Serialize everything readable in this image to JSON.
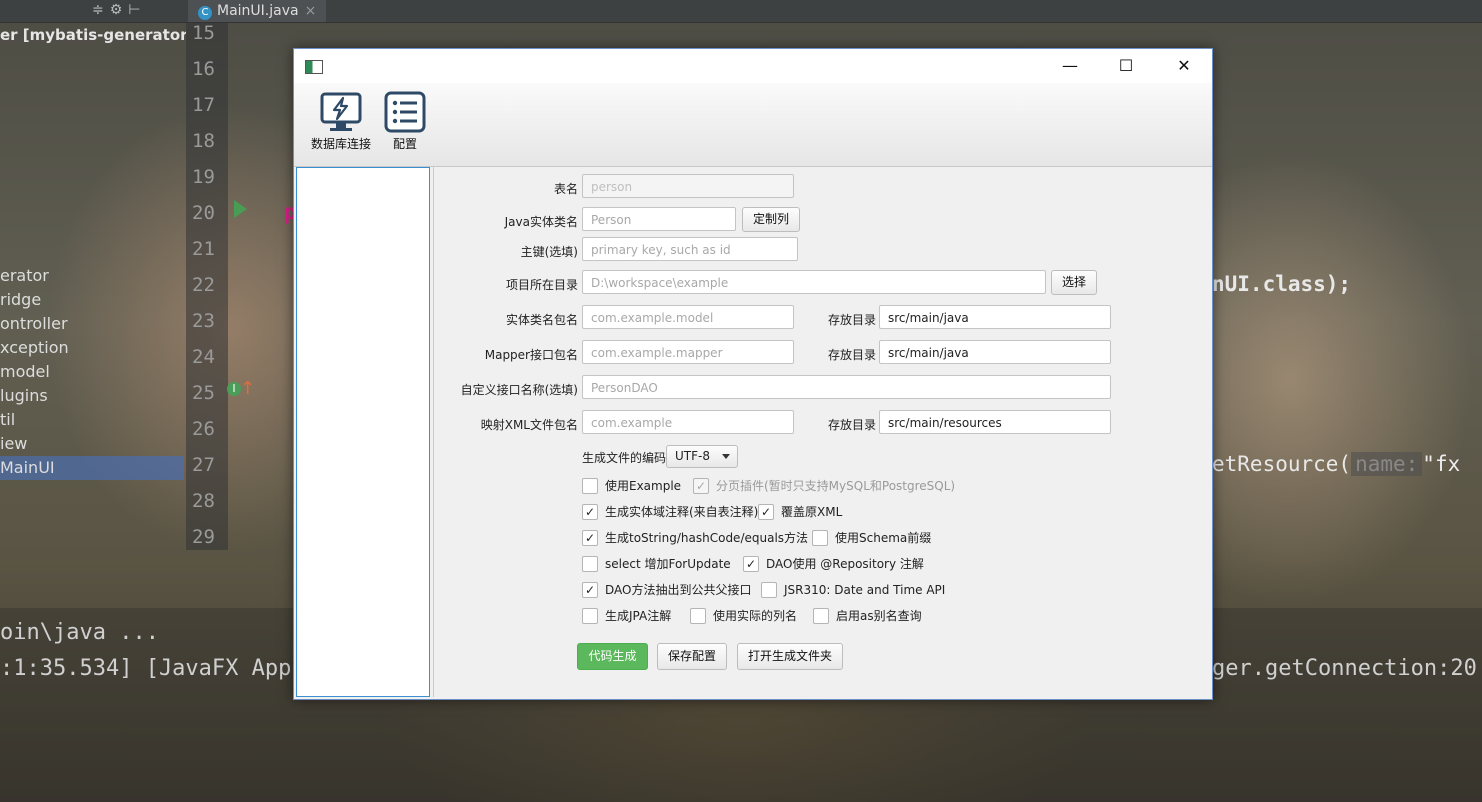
{
  "ide": {
    "tab_label": "MainUI.java",
    "project_title": "er [mybatis-generator-gu",
    "project_items": [
      "erator",
      "ridge",
      "ontroller",
      "xception",
      "model",
      "lugins",
      "til",
      "iew",
      "MainUI"
    ],
    "line_numbers": [
      "15",
      "16",
      "17",
      "18",
      "19",
      "20",
      "21",
      "22",
      "23",
      "24",
      "25",
      "26",
      "27",
      "28",
      "29"
    ],
    "code_line22": "nUI.class);",
    "code_line27_a": "etResource(",
    "code_line27_hint": "name:",
    "code_line27_b": "\"fx",
    "code_line20": "p",
    "console_line1": "oin\\java ...",
    "console_line2": ":1:35.534] [JavaFX App",
    "console_line2_right": "ger.getConnection:20"
  },
  "dialog": {
    "window_controls": {
      "minimize": "—",
      "maximize": "☐",
      "close": "✕"
    },
    "toolbar": {
      "db_connect_label": "数据库连接",
      "config_label": "配置"
    },
    "form": {
      "table_name": {
        "label": "表名",
        "placeholder": "person"
      },
      "entity_name": {
        "label": "Java实体类名",
        "placeholder": "Person",
        "button": "定制列"
      },
      "primary_key": {
        "label": "主键(选填)",
        "placeholder": "primary key, such as id"
      },
      "project_dir": {
        "label": "项目所在目录",
        "placeholder": "D:\\workspace\\example",
        "button": "选择"
      },
      "model_package": {
        "label": "实体类名包名",
        "placeholder": "com.example.model",
        "dir_label": "存放目录",
        "dir_value": "src/main/java"
      },
      "mapper_package": {
        "label": "Mapper接口包名",
        "placeholder": "com.example.mapper",
        "dir_label": "存放目录",
        "dir_value": "src/main/java"
      },
      "custom_interface": {
        "label": "自定义接口名称(选填)",
        "placeholder": "PersonDAO"
      },
      "xml_package": {
        "label": "映射XML文件包名",
        "placeholder": "com.example",
        "dir_label": "存放目录",
        "dir_value": "src/main/resources"
      },
      "encoding": {
        "label": "生成文件的编码",
        "value": "UTF-8"
      }
    },
    "options": [
      {
        "label": "使用Example",
        "checked": false
      },
      {
        "label": "分页插件(暂时只支持MySQL和PostgreSQL)",
        "checked": true,
        "disabled": true
      },
      {
        "label": "生成实体域注释(来自表注释)",
        "checked": true
      },
      {
        "label": "覆盖原XML",
        "checked": true
      },
      {
        "label": "生成toString/hashCode/equals方法",
        "checked": true
      },
      {
        "label": "使用Schema前缀",
        "checked": false
      },
      {
        "label": "select 增加ForUpdate",
        "checked": false
      },
      {
        "label": "DAO使用 @Repository 注解",
        "checked": true
      },
      {
        "label": "DAO方法抽出到公共父接口",
        "checked": true
      },
      {
        "label": "JSR310: Date and Time API",
        "checked": false
      },
      {
        "label": "生成JPA注解",
        "checked": false
      },
      {
        "label": "使用实际的列名",
        "checked": false
      },
      {
        "label": "启用as别名查询",
        "checked": false
      }
    ],
    "actions": {
      "generate": "代码生成",
      "save_config": "保存配置",
      "open_folder": "打开生成文件夹"
    }
  },
  "colors": {
    "accent_green": "#5cb85c",
    "focus_blue": "#3a8fd0"
  }
}
